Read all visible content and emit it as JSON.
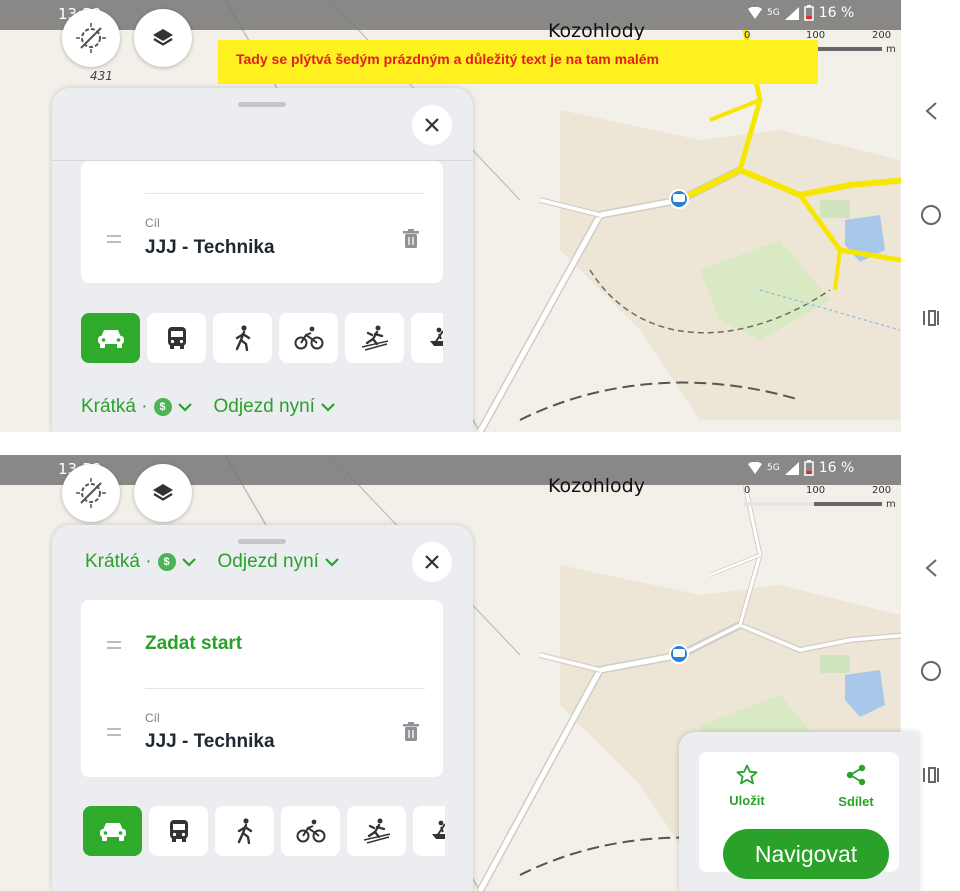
{
  "status_bar": {
    "time": "13:58",
    "network": "5G",
    "battery": "16 %"
  },
  "map": {
    "place_name": "Kozohlody",
    "heading": "431",
    "scale": {
      "labels": [
        "0",
        "100",
        "200"
      ],
      "unit": "m"
    }
  },
  "annotation": {
    "text": "Tady se plýtvá šedým prázdným a důležitý text je na tam malém"
  },
  "route_panel": {
    "start_placeholder": "Zadat start",
    "destination_label": "Cíl",
    "destination_value": "JJJ - Technika",
    "route_type": "Krátká ·",
    "toll_symbol": "$",
    "departure": "Odjezd nyní",
    "transport_modes": [
      "car",
      "bus",
      "walk",
      "bike",
      "ski",
      "boat"
    ],
    "active_mode": "car"
  },
  "actions": {
    "save": "Uložit",
    "share": "Sdílet",
    "navigate": "Navigovat"
  },
  "colors": {
    "accent": "#2aa22a",
    "annotation_bg": "#fff11f",
    "annotation_text": "#e0201c",
    "main_road": "#f7e600"
  }
}
